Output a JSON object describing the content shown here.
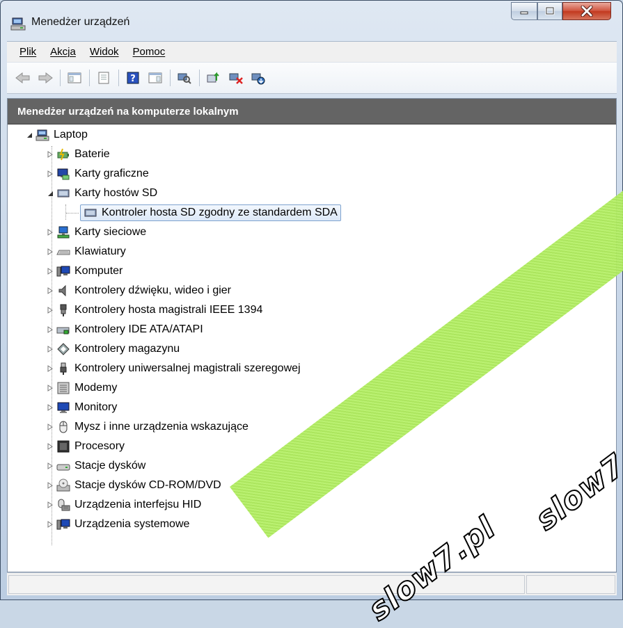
{
  "window": {
    "title": "Menedżer urządzeń"
  },
  "menu": {
    "items": [
      "Plik",
      "Akcja",
      "Widok",
      "Pomoc"
    ]
  },
  "toolbar": {
    "buttons": [
      "back-arrow",
      "forward-arrow",
      "console-tree",
      "properties",
      "help",
      "action-pane",
      "scan-hardware",
      "update-driver",
      "disable-device",
      "uninstall-device"
    ]
  },
  "header": {
    "title": "Menedżer urządzeń na komputerze lokalnym"
  },
  "tree": {
    "root": "Laptop",
    "categories": [
      {
        "label": "Baterie",
        "icon": "battery-icon"
      },
      {
        "label": "Karty graficzne",
        "icon": "display-adapter-icon"
      },
      {
        "label": "Karty hostów SD",
        "icon": "sd-host-icon",
        "expanded": true,
        "children": [
          {
            "label": "Kontroler hosta SD zgodny ze standardem SDA",
            "selected": true
          }
        ]
      },
      {
        "label": "Karty sieciowe",
        "icon": "network-adapter-icon"
      },
      {
        "label": "Klawiatury",
        "icon": "keyboard-icon"
      },
      {
        "label": "Komputer",
        "icon": "computer-icon"
      },
      {
        "label": "Kontrolery dźwięku, wideo i gier",
        "icon": "speaker-icon"
      },
      {
        "label": "Kontrolery hosta magistrali IEEE 1394",
        "icon": "firewire-icon"
      },
      {
        "label": "Kontrolery IDE ATA/ATAPI",
        "icon": "ide-controller-icon"
      },
      {
        "label": "Kontrolery magazynu",
        "icon": "storage-controller-icon"
      },
      {
        "label": "Kontrolery uniwersalnej magistrali szeregowej",
        "icon": "usb-icon"
      },
      {
        "label": "Modemy",
        "icon": "modem-icon"
      },
      {
        "label": "Monitory",
        "icon": "monitor-icon"
      },
      {
        "label": "Mysz i inne urządzenia wskazujące",
        "icon": "mouse-icon"
      },
      {
        "label": "Procesory",
        "icon": "processor-icon"
      },
      {
        "label": "Stacje dysków",
        "icon": "disk-drive-icon"
      },
      {
        "label": "Stacje dysków CD-ROM/DVD",
        "icon": "cdrom-icon"
      },
      {
        "label": "Urządzenia interfejsu HID",
        "icon": "hid-icon"
      },
      {
        "label": "Urządzenia systemowe",
        "icon": "system-devices-icon"
      }
    ]
  },
  "watermark": {
    "text": "slow7.pl",
    "text_partial": "slow7.p",
    "band_color": "#b4ec66"
  }
}
